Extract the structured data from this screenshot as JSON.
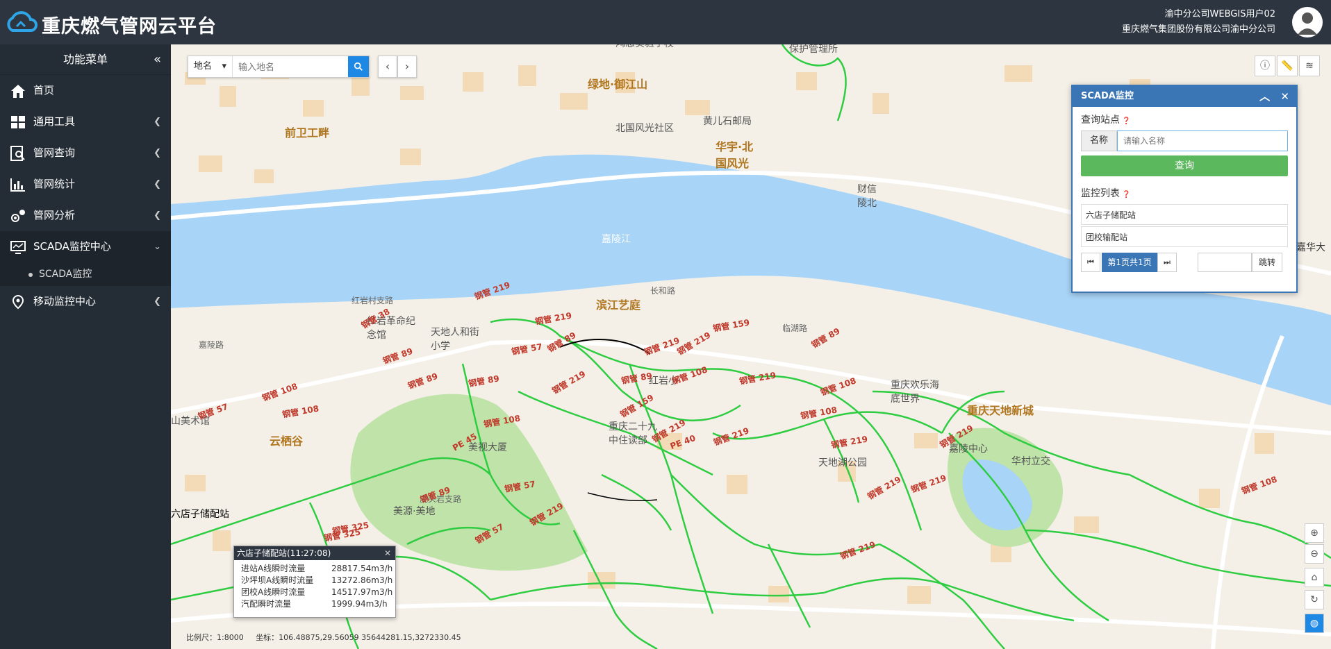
{
  "header": {
    "brand": "重庆燃气管网云平台",
    "user_line1": "渝中分公司WEBGIS用户02",
    "user_line2": "重庆燃气集团股份有限公司渝中分公司"
  },
  "sidebar": {
    "title": "功能菜单",
    "items": [
      {
        "label": "首页",
        "icon": "home-icon"
      },
      {
        "label": "通用工具",
        "icon": "grid-icon"
      },
      {
        "label": "管网查询",
        "icon": "search-doc-icon"
      },
      {
        "label": "管网统计",
        "icon": "bar-chart-icon"
      },
      {
        "label": "管网分析",
        "icon": "analysis-icon"
      },
      {
        "label": "SCADA监控中心",
        "icon": "monitor-icon"
      },
      {
        "label": "移动监控中心",
        "icon": "location-icon"
      }
    ],
    "sub_item": "SCADA监控"
  },
  "search": {
    "type": "地名",
    "placeholder": "输入地名"
  },
  "scada": {
    "title": "SCADA监控",
    "query_section": "查询站点",
    "name_label": "名称",
    "name_placeholder": "请输入名称",
    "query_button": "查询",
    "list_section": "监控列表",
    "stations": [
      "六店子储配站",
      "团校输配站"
    ],
    "pager_text": "第1页共1页",
    "jump_label": "跳转"
  },
  "popup": {
    "title": "六店子储配站(11:27:08)",
    "rows": [
      {
        "label": "进站A线瞬时流量",
        "value": "28817.54m3/h"
      },
      {
        "label": "沙坪坝A线瞬时流量",
        "value": "13272.86m3/h"
      },
      {
        "label": "团校A线瞬时流量",
        "value": "14517.97m3/h"
      },
      {
        "label": "汽配瞬时流量",
        "value": "1999.94m3/h"
      }
    ]
  },
  "status": {
    "scale": "比例尺：1:8000",
    "coords": "坐标：106.48875,29.56059    35644281.15,3272330.45"
  },
  "map_labels": {
    "l1": "鸿恩实验学校",
    "l2": "保护管理所",
    "l3": "绿地·御江山",
    "l4": "前卫工畔",
    "l5": "北国风光社区",
    "l6": "黄儿石邮局",
    "l7": "华宇·北国风光",
    "l8": "嘉陵江",
    "l9": "嘉华大",
    "l10": "红岩村支路",
    "l11": "红岩革命纪念馆",
    "l12": "天地人和街小学",
    "l13": "嘉陵路",
    "l14": "长和路",
    "l15": "滨江艺庭",
    "l16": "红岩小",
    "l17": "临湖路",
    "l18": "重庆欢乐海底世界",
    "l19": "重庆天地新城",
    "l20": "山美术馆",
    "l21": "云栖谷",
    "l22": "重庆二十九中住读部",
    "l23": "美视大厦",
    "l24": "天地湖公园",
    "l25": "嘉陵中心",
    "l26": "华村立交",
    "l27": "虎头岩支路",
    "l28": "美源·美地",
    "l29": "六店子储配站",
    "l30": "陵北",
    "l31": "财信"
  },
  "pipe_labels": [
    "钢管 219",
    "钢管 219",
    "钢管 38",
    "钢管 89",
    "钢管 57",
    "钢管 89",
    "钢管 219",
    "钢管 159",
    "钢管 219",
    "钢管 89",
    "钢管 89",
    "钢管 219",
    "钢管 108",
    "钢管 89",
    "钢管 159",
    "钢管 108",
    "钢管 108",
    "钢管 108",
    "钢管 57",
    "钢管 108",
    "钢管 89",
    "钢管 108",
    "钢管 108",
    "钢管 219",
    "钢管 219",
    "钢管 219",
    "钢管 219",
    "钢管 219",
    "钢管 57",
    "钢管 219",
    "钢管 89",
    "钢管 325",
    "钢管 57",
    "钢管 219",
    "钢管 325",
    "PE 45",
    "PE 40",
    "钢管 219",
    "钢管 219",
    "钢管 108"
  ],
  "colors": {
    "header": "#2d3540",
    "sidebar": "#242c35",
    "river": "#a8d4f7",
    "pipe": "#2ecc40",
    "accent": "#3a76b5",
    "query": "#5cb85c"
  }
}
